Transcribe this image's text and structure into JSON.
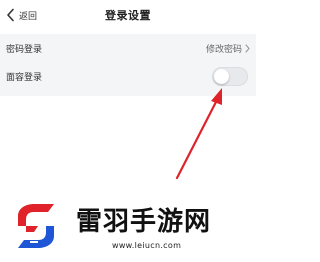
{
  "header": {
    "back_label": "返回",
    "title": "登录设置"
  },
  "settings": {
    "password_login": {
      "label": "密码登录",
      "value": "修改密码"
    },
    "face_login": {
      "label": "面容登录",
      "enabled": false
    }
  },
  "watermark": {
    "site_name": "雷羽手游网",
    "url": "www.leiucn.com"
  },
  "colors": {
    "settings_bg": "#f4f5f7",
    "toggle_off": "#e8e9ed",
    "arrow": "#e0232a",
    "logo_red": "#e0232a",
    "logo_blue": "#1e56d6"
  },
  "icons": {
    "back": "chevron-left-icon",
    "value_chevron": "chevron-right-icon",
    "logo": "site-logo"
  }
}
